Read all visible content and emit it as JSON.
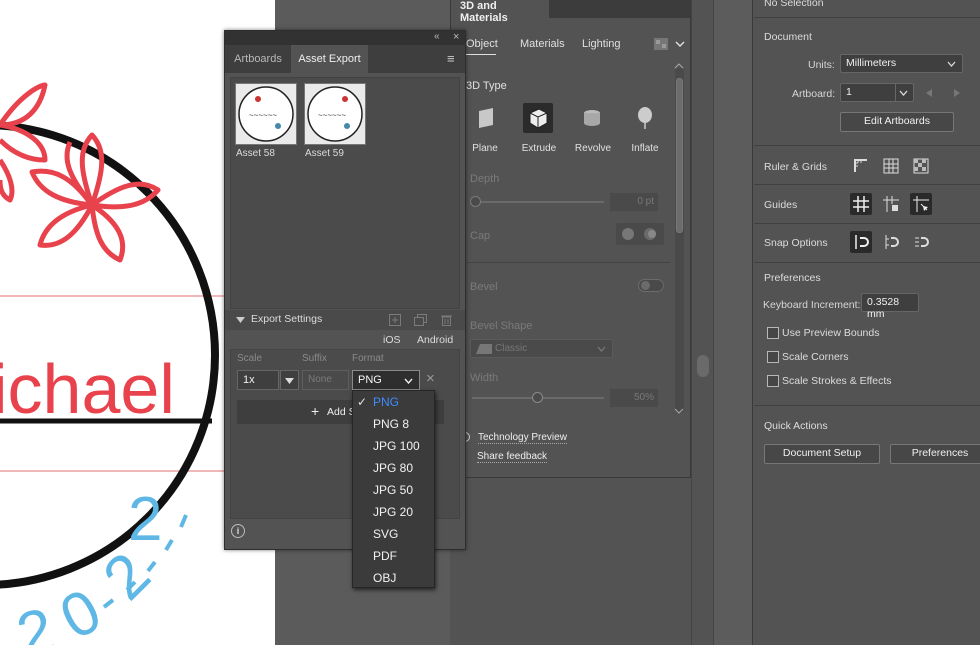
{
  "artboard": {
    "name_text": "ichael",
    "year_text": "2022",
    "colors": {
      "red": "#e8424c",
      "blue": "#5fb7e6",
      "black": "#111111",
      "guide": "#e07070"
    }
  },
  "asset_export": {
    "tabs": [
      "Artboards",
      "Asset Export"
    ],
    "assets": [
      {
        "label": "Asset 58"
      },
      {
        "label": "Asset 59"
      }
    ],
    "export_settings_label": "Export Settings",
    "platforms": [
      "iOS",
      "Android"
    ],
    "col_scale": "Scale",
    "col_suffix": "Suffix",
    "col_format": "Format",
    "scale_value": "1x",
    "suffix_placeholder": "None",
    "format_value": "PNG",
    "add_scale_label": "Add S",
    "format_options": [
      "PNG",
      "PNG 8",
      "JPG 100",
      "JPG 80",
      "JPG 50",
      "JPG 20",
      "SVG",
      "PDF",
      "OBJ"
    ],
    "selected_format": "PNG"
  },
  "panel3d": {
    "tab_label": "3D and Materials",
    "subtabs": [
      "Object",
      "Materials",
      "Lighting"
    ],
    "section_3d_type": "3D Type",
    "types": [
      "Plane",
      "Extrude",
      "Revolve",
      "Inflate"
    ],
    "selected_type": "Extrude",
    "depth_label": "Depth",
    "depth_value": "0 pt",
    "cap_label": "Cap",
    "bevel_label": "Bevel",
    "bevel_shape_label": "Bevel Shape",
    "bevel_shape_value": "Classic",
    "width_label": "Width",
    "width_value": "50%",
    "tech_preview": "Technology Preview",
    "share_feedback": "Share feedback"
  },
  "properties": {
    "no_selection": "No Selection",
    "document_title": "Document",
    "units_label": "Units:",
    "units_value": "Millimeters",
    "artboard_label": "Artboard:",
    "artboard_value": "1",
    "edit_artboards": "Edit Artboards",
    "ruler_grids": "Ruler & Grids",
    "guides": "Guides",
    "snap_options": "Snap Options",
    "preferences_title": "Preferences",
    "keyboard_increment_label": "Keyboard Increment:",
    "keyboard_increment_value": "0.3528 mm",
    "use_preview_bounds": "Use Preview Bounds",
    "scale_corners": "Scale Corners",
    "scale_strokes": "Scale Strokes & Effects",
    "quick_actions": "Quick Actions",
    "document_setup": "Document Setup",
    "preferences_btn": "Preferences"
  }
}
